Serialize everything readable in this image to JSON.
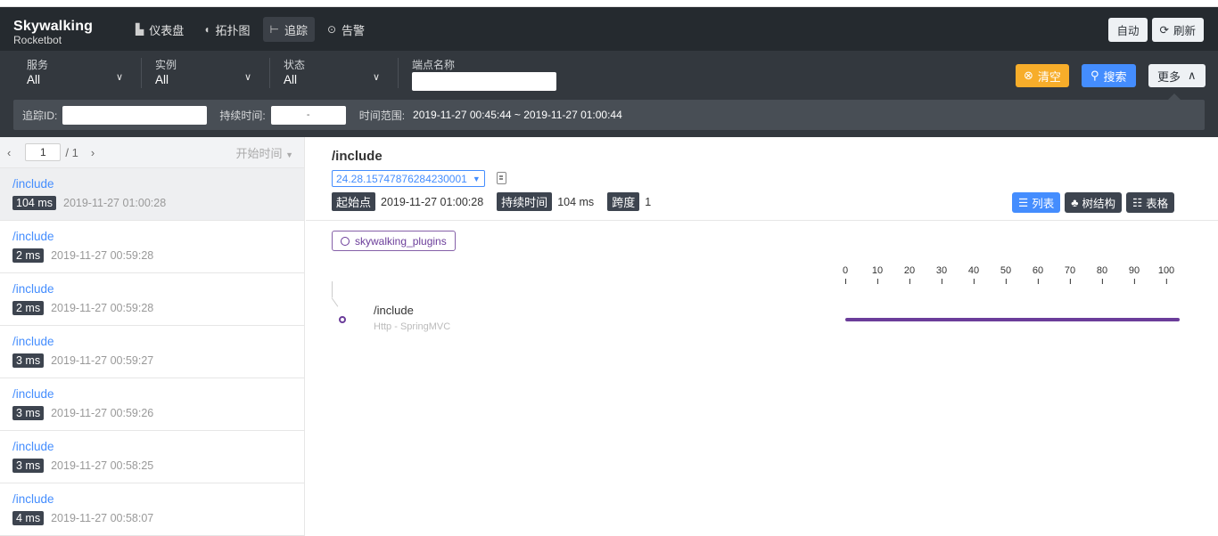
{
  "header": {
    "logo_name": "Skywalking",
    "logo_sub": "Rocketbot",
    "nav": [
      {
        "label": "仪表盘",
        "icon": "dashboard-icon"
      },
      {
        "label": "拓扑图",
        "icon": "topology-icon"
      },
      {
        "label": "追踪",
        "icon": "trace-icon"
      },
      {
        "label": "告警",
        "icon": "alarm-icon"
      }
    ],
    "active_nav": "追踪",
    "auto_label": "自动",
    "refresh_label": "刷新"
  },
  "filters": {
    "service": {
      "label": "服务",
      "value": "All"
    },
    "instance": {
      "label": "实例",
      "value": "All"
    },
    "status": {
      "label": "状态",
      "value": "All"
    },
    "endpoint": {
      "label": "端点名称",
      "value": ""
    },
    "clear_label": "清空",
    "search_label": "搜索",
    "more_label": "更多",
    "trace_id_label": "追踪ID:",
    "duration_label": "持续时间:",
    "duration_sep": "-",
    "time_range_label": "时间范围:",
    "time_range_value": "2019-11-27 00:45:44 ~ 2019-11-27 01:00:44"
  },
  "pager": {
    "page": "1",
    "total": "/ 1",
    "sort_label": "开始时间"
  },
  "traces": [
    {
      "name": "/include",
      "duration": "104 ms",
      "time": "2019-11-27 01:00:28"
    },
    {
      "name": "/include",
      "duration": "2 ms",
      "time": "2019-11-27 00:59:28"
    },
    {
      "name": "/include",
      "duration": "2 ms",
      "time": "2019-11-27 00:59:28"
    },
    {
      "name": "/include",
      "duration": "3 ms",
      "time": "2019-11-27 00:59:27"
    },
    {
      "name": "/include",
      "duration": "3 ms",
      "time": "2019-11-27 00:59:26"
    },
    {
      "name": "/include",
      "duration": "3 ms",
      "time": "2019-11-27 00:58:25"
    },
    {
      "name": "/include",
      "duration": "4 ms",
      "time": "2019-11-27 00:58:07"
    }
  ],
  "detail": {
    "title": "/include",
    "trace_id": "24.28.15747876284230001",
    "start_label": "起始点",
    "start_value": "2019-11-27 01:00:28",
    "duration_label": "持续时间",
    "duration_value": "104 ms",
    "span_label": "跨度",
    "span_value": "1",
    "view_list": "列表",
    "view_tree": "树结构",
    "view_table": "表格",
    "service_tag": "skywalking_plugins",
    "axis_ticks": [
      "0",
      "10",
      "20",
      "30",
      "40",
      "50",
      "60",
      "70",
      "80",
      "90",
      "100"
    ],
    "span": {
      "name": "/include",
      "sub": "Http - SpringMVC",
      "start_pct": 0,
      "end_pct": 104
    }
  },
  "colors": {
    "accent": "#448dfe",
    "warning": "#f7ad2a",
    "span": "#6b3d9a",
    "header_bg": "#252a2f"
  }
}
